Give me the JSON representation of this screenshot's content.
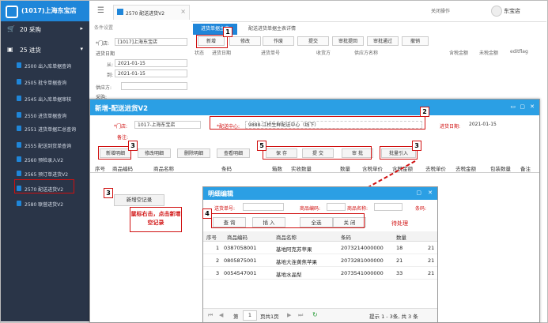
{
  "colors": {
    "accent": "#1f86d9",
    "sidebar": "#2a3548",
    "dialog_title": "#2b9fe4",
    "annotation": "#d01010"
  },
  "brand": {
    "title": "(1017)上海东宝店"
  },
  "sidebar": {
    "menu": [
      {
        "label": "20 采购",
        "icon": "cart-icon"
      },
      {
        "label": "25 进货",
        "icon": "truck-icon"
      }
    ],
    "items": [
      {
        "label": "2500 出入库单据查询"
      },
      {
        "label": "2505 批令单据查询"
      },
      {
        "label": "2545 出入库单据审核"
      },
      {
        "label": "2550 进货单据查询"
      },
      {
        "label": "2551 进货单据汇总查询"
      },
      {
        "label": "2555 配送到货单查询"
      },
      {
        "label": "2560 预检录入V2"
      },
      {
        "label": "2565 预订单进货V2"
      },
      {
        "label": "2570 配送进货V2"
      },
      {
        "label": "2580 联营进货V2"
      }
    ]
  },
  "topbar": {
    "tab": "2570 配送进货V2",
    "close_ops": "关闭操作",
    "user": "东宝店"
  },
  "filter": {
    "title": "条件设置",
    "store_label": "*门店:",
    "store_value": "[1017]上海东宝店",
    "date_label": "进货日期",
    "from_label": "从:",
    "from_value": "2021-01-15",
    "to_label": "到:",
    "to_value": "2021-01-15",
    "supplier_label": "供应方:",
    "buyer_label": "采购:"
  },
  "main": {
    "tabs": [
      "进货单据主表",
      "配送进货单据主表详情"
    ],
    "toolbar": [
      "新增",
      "修改",
      "作废",
      "提交",
      "审批提回",
      "审批通过",
      "撤销"
    ],
    "columns": [
      "状态",
      "进货日期",
      "进货单号",
      "收货方",
      "供应方名称",
      "含税金额",
      "未税金额",
      "editflag"
    ]
  },
  "dialog": {
    "title": "新增-配送进货V2",
    "store_label": "*门店:",
    "store_value": "1017-上海东宝店",
    "center_label": "*配送中心:",
    "center_value": "9888-江桥生鲜配送中心（线下）",
    "date_label": "进货日期:",
    "date_value": "2021-01-15",
    "remark_label": "备注:",
    "buttons": [
      "新增明细",
      "修改明细",
      "删除明细",
      "查看明细",
      "保 存",
      "提 交",
      "审 批",
      "批量引入"
    ],
    "columns": [
      "序号",
      "商品编码",
      "商品名称",
      "条码",
      "箱数",
      "实收数量",
      "数量",
      "含税单价",
      "含税金额",
      "去税单价",
      "去税金额",
      "包装数量",
      "备注"
    ],
    "context_menu": "新增空记录"
  },
  "subdialog": {
    "title": "明细编辑",
    "doc_label": "送货单号:",
    "code_label": "商品编码:",
    "name_label": "商品名称:",
    "barcode_label": "条码:",
    "buttons": [
      "查 询",
      "插 入",
      "全选",
      "关 闭"
    ],
    "pending": "待处理",
    "columns": [
      "序号",
      "商品编码",
      "商品名称",
      "条码",
      "数量"
    ],
    "rows": [
      {
        "no": "1",
        "code": "0387058001",
        "name": "基地阿克苏苹果",
        "barcode": "2073214000000",
        "qty": "18",
        "more": "21"
      },
      {
        "no": "2",
        "code": "0805875001",
        "name": "基地大连黄焦苹果",
        "barcode": "2073281000000",
        "qty": "21",
        "more": "21"
      },
      {
        "no": "3",
        "code": "0054547001",
        "name": "基地水晶梨",
        "barcode": "2073541000000",
        "qty": "33",
        "more": "21"
      }
    ],
    "pager": {
      "page_label": "第",
      "page": "1",
      "of": "页共1页",
      "info": "提示 1 - 3条, 共 3 条"
    }
  },
  "annotations": {
    "n1": "1",
    "n2": "2",
    "n3a": "3",
    "n3b": "3",
    "n3c": "3",
    "n4": "4",
    "n5": "5",
    "callout": "鼠标右击，点击新增空记录"
  }
}
